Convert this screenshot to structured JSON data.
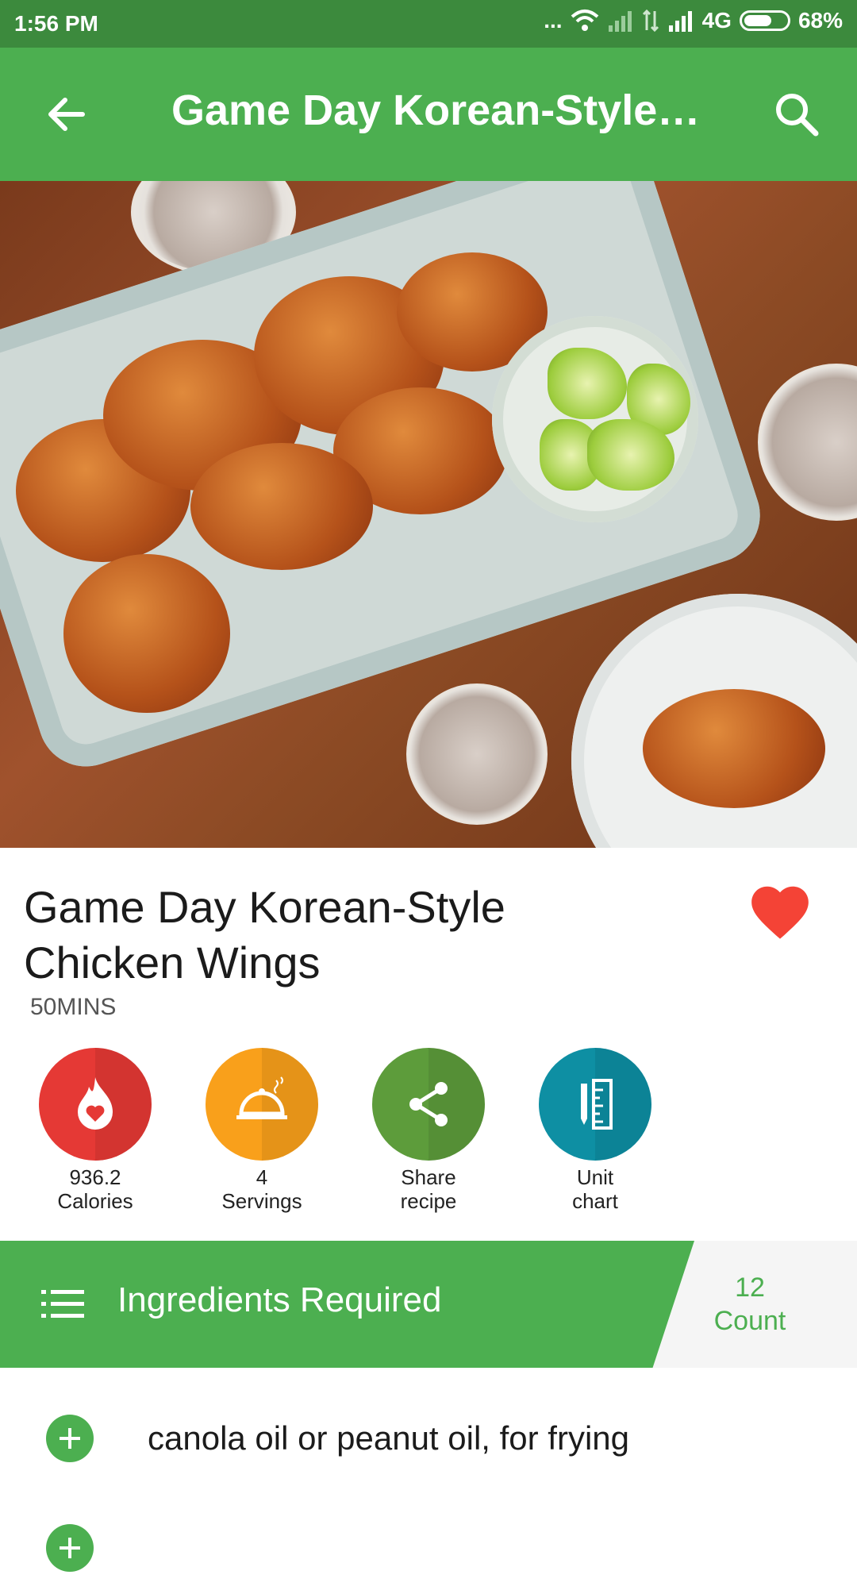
{
  "status": {
    "time": "1:56 PM",
    "dots": "...",
    "network": "4G",
    "battery": "68%",
    "battery_fraction": 0.68
  },
  "appbar": {
    "title": "Game Day Korean-Style…",
    "back_icon": "arrow-left-icon",
    "search_icon": "search-icon"
  },
  "recipe": {
    "title_line1": "Game Day Korean-Style",
    "title_line2": "Chicken Wings",
    "duration": "50MINS",
    "favorite": true
  },
  "actions": [
    {
      "line1": "936.2",
      "line2": "Calories",
      "color": "#e53935",
      "icon": "calories-flame-heart-icon"
    },
    {
      "line1": "4",
      "line2": "Servings",
      "color": "#f9a01b",
      "icon": "cloche-servings-icon"
    },
    {
      "line1": "Share",
      "line2": "recipe",
      "color": "#5d9c3b",
      "icon": "share-icon"
    },
    {
      "line1": "Unit",
      "line2": "chart",
      "color": "#0e8fa3",
      "icon": "unit-chart-icon"
    }
  ],
  "ingredients": {
    "header": "Ingredients Required",
    "count_value": "12",
    "count_label": "Count",
    "items": [
      "canola oil or peanut oil, for frying",
      ""
    ]
  },
  "colors": {
    "primary": "#4caf50",
    "status_bar": "#3c8a3d",
    "heart": "#f44336"
  }
}
